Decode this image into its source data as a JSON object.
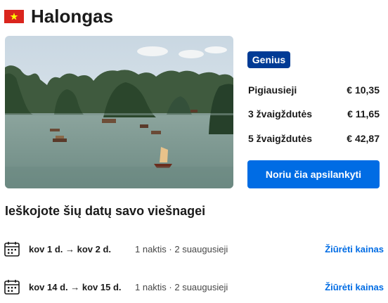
{
  "header": {
    "title": "Halongas",
    "flag_icon": "vietnam-flag-icon"
  },
  "photo": {
    "alt_icon": "halong-bay-photo"
  },
  "genius_badge": "Genius",
  "prices": [
    {
      "label": "Pigiausieji",
      "value": "€ 10,35"
    },
    {
      "label": "3 žvaigždutės",
      "value": "€ 11,65"
    },
    {
      "label": "5 žvaigždutės",
      "value": "€ 42,87"
    }
  ],
  "cta_label": "Noriu čia apsilankyti",
  "section_title": "Ieškojote šių datų savo viešnagei",
  "searches": [
    {
      "dates": "kov 1 d. → kov 2 d.",
      "guests": "1 naktis · 2 suaugusieji",
      "link": "Žiūrėti kainas"
    },
    {
      "dates": "kov 14 d. → kov 15 d.",
      "guests": "1 naktis · 2 suaugusieji",
      "link": "Žiūrėti kainas"
    }
  ],
  "colors": {
    "brand_dark": "#003b95",
    "primary": "#006ce4",
    "flag_red": "#da251d",
    "flag_star": "#ffff00"
  }
}
